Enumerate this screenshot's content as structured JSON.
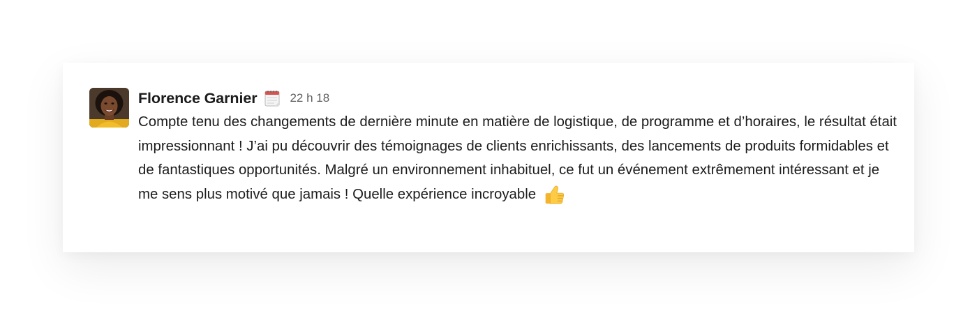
{
  "message": {
    "author": "Florence Garnier",
    "status_icon": "calendar-icon",
    "timestamp": "22 h 18",
    "text_main": "Compte tenu des changements de dernière minute en matière de logistique, de programme et d’horaires, le résultat était impressionnant ! J’ai pu découvrir des témoignages de clients enrichissants, des lancements de produits formidables et de fantastiques opportunités. Malgré un environnement inhabituel, ce fut un événement extrêmement intéressant et je me sens plus motivé que jamais ! Quelle",
    "text_end": "expérience incroyable",
    "reaction_emoji": "thumbs-up-icon"
  },
  "colors": {
    "text": "#1d1c1d",
    "muted": "#616061",
    "background": "#ffffff"
  }
}
